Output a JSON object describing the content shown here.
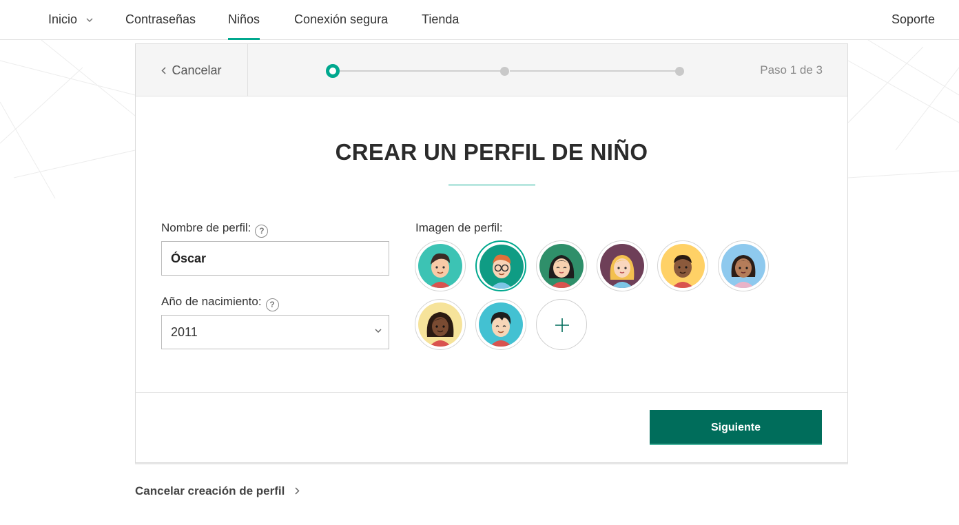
{
  "nav": {
    "items": [
      {
        "label": "Inicio",
        "has_dropdown": true,
        "active": false
      },
      {
        "label": "Contraseñas",
        "active": false
      },
      {
        "label": "Niños",
        "active": true
      },
      {
        "label": "Conexión segura",
        "active": false
      },
      {
        "label": "Tienda",
        "active": false
      }
    ],
    "support_label": "Soporte"
  },
  "wizard": {
    "cancel_label": "Cancelar",
    "current_step": 1,
    "total_steps": 3,
    "step_text": "Paso 1 de 3",
    "title": "CREAR UN PERFIL DE NIÑO",
    "profile_name_label": "Nombre de perfil:",
    "profile_name_value": "Óscar",
    "birth_year_label": "Año de nacimiento:",
    "birth_year_value": "2011",
    "image_label": "Imagen de perfil:",
    "avatars": [
      {
        "name": "boy-dark-hair",
        "bg": "#3cc3b4",
        "selected": false
      },
      {
        "name": "boy-red-hair-glasses",
        "bg": "#0f9c84",
        "selected": true
      },
      {
        "name": "girl-black-hair",
        "bg": "#2f8f6a",
        "selected": false
      },
      {
        "name": "girl-blonde",
        "bg": "#6e3f58",
        "selected": false
      },
      {
        "name": "boy-dark-skin",
        "bg": "#ffd166",
        "selected": false
      },
      {
        "name": "girl-dark-hair",
        "bg": "#8ec9ee",
        "selected": false
      },
      {
        "name": "girl-dark-skin",
        "bg": "#f6e39a",
        "selected": false
      },
      {
        "name": "boy-asian",
        "bg": "#43c1d2",
        "selected": false
      }
    ],
    "next_label": "Siguiente"
  },
  "footer": {
    "cancel_creation_label": "Cancelar creación de perfil"
  },
  "colors": {
    "accent": "#00a88e",
    "primary_button": "#006d5b"
  }
}
